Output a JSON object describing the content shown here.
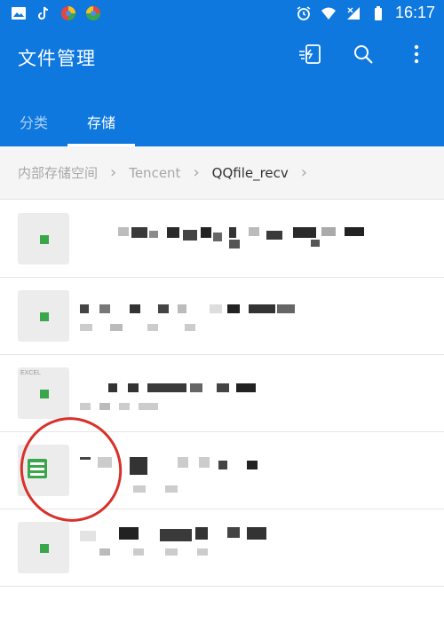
{
  "status_bar": {
    "time": "16:17",
    "left_icons": [
      "image-icon",
      "tiktok-icon",
      "app-icon",
      "app-icon"
    ],
    "right_icons": [
      "alarm-icon",
      "wifi-icon",
      "signal-icon",
      "battery-icon"
    ]
  },
  "header": {
    "title": "文件管理",
    "actions": [
      "transfer-icon",
      "search-icon",
      "more-vert-icon"
    ],
    "tabs": [
      {
        "label": "分类",
        "active": false
      },
      {
        "label": "存储",
        "active": true
      }
    ]
  },
  "breadcrumb": [
    "内部存储空间",
    "Tencent",
    "QQfile_recv"
  ],
  "files": [
    {
      "icon": "file-icon",
      "tag": ""
    },
    {
      "icon": "file-icon",
      "tag": ""
    },
    {
      "icon": "excel-file-icon",
      "tag": "EXCEL"
    },
    {
      "icon": "spreadsheet-file-icon",
      "tag": ""
    },
    {
      "icon": "file-icon",
      "tag": ""
    }
  ],
  "colors": {
    "appbar": "#0f78df",
    "breadcrumb_bg": "#f5f5f5",
    "file_accent": "#3aa64a",
    "annotation": "#d8312a"
  }
}
